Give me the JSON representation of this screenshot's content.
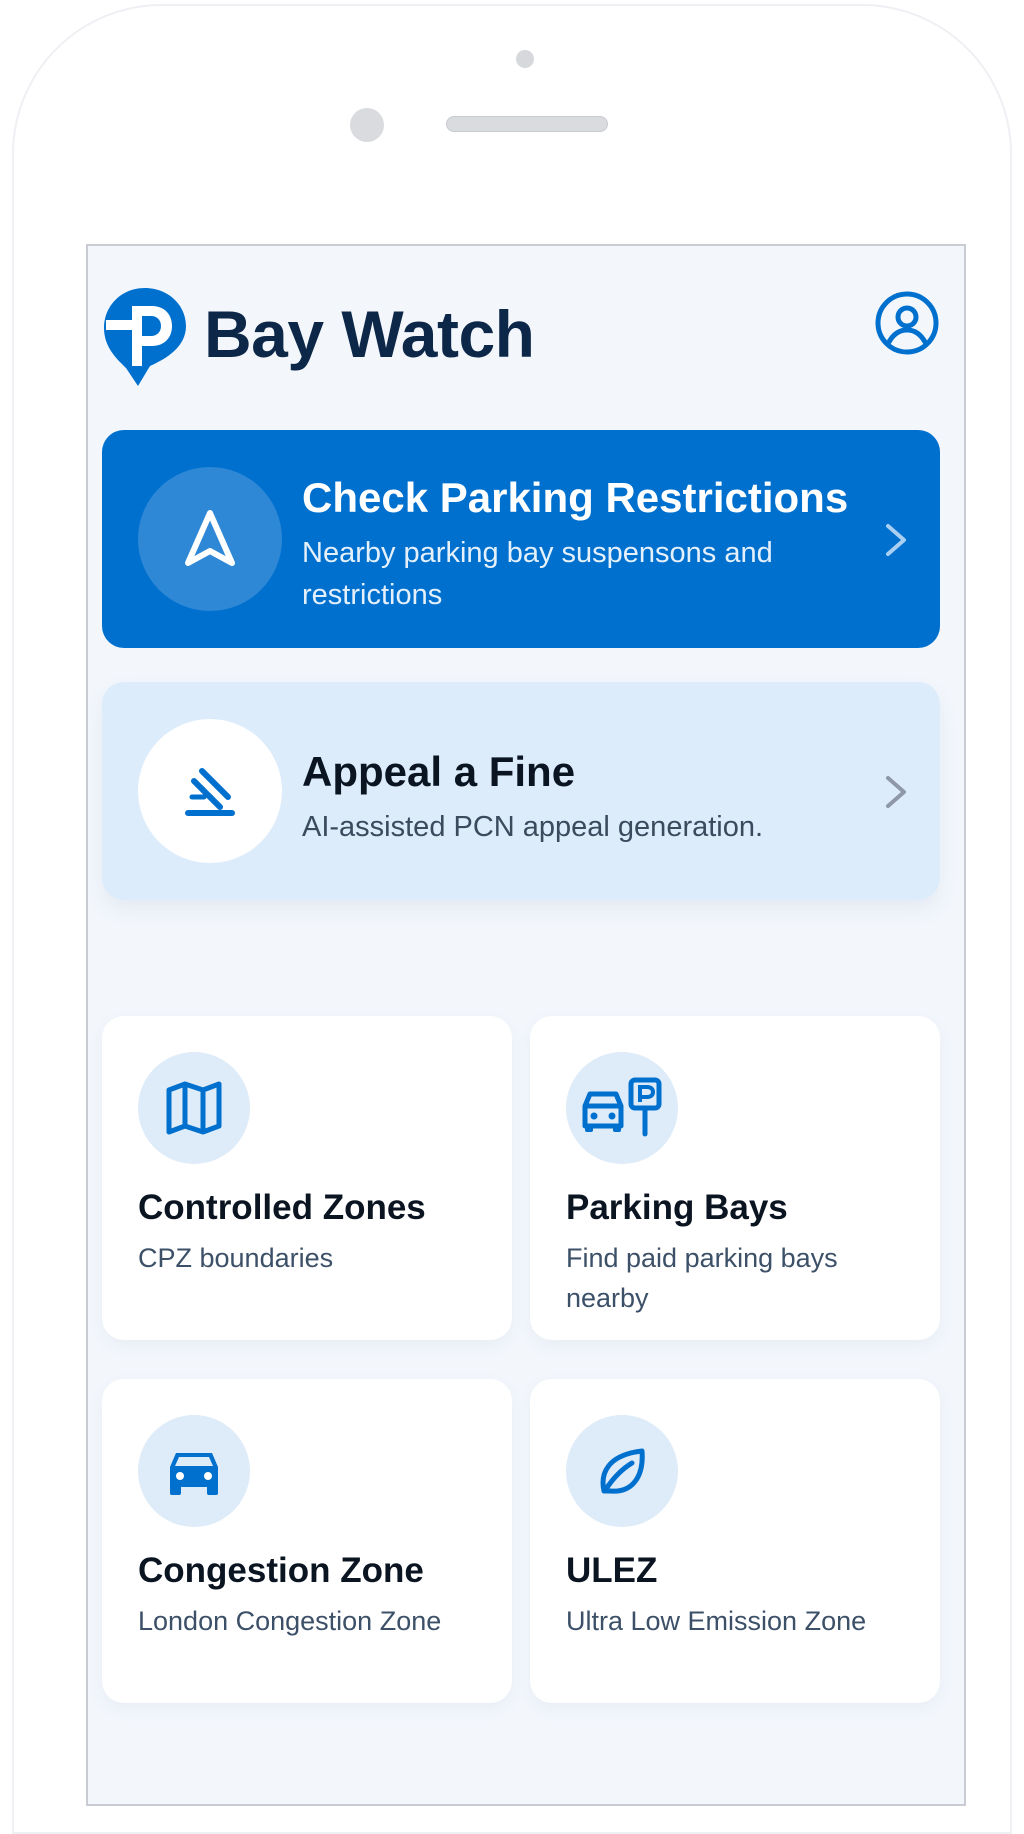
{
  "app": {
    "title": "Bay Watch",
    "logo_icon": "parking-pin-logo",
    "account_icon": "user-circle-icon"
  },
  "colors": {
    "primary": "#0070CE",
    "secondary_card": "#DDECFB",
    "heading": "#0C2748",
    "screen_bg": "#F3F7FC"
  },
  "hero_cards": [
    {
      "title": "Check Parking Restrictions",
      "subtitle": "Nearby parking bay suspensons and restrictions",
      "icon": "navigation-arrow-icon"
    },
    {
      "title": "Appeal a Fine",
      "subtitle": "AI-assisted PCN appeal generation.",
      "icon": "gavel-icon"
    }
  ],
  "tiles": [
    {
      "title": "Controlled Zones",
      "subtitle": "CPZ boundaries",
      "icon": "map-icon"
    },
    {
      "title": "Parking Bays",
      "subtitle": "Find paid parking bays nearby",
      "icon": "car-parking-sign-icon"
    },
    {
      "title": "Congestion Zone",
      "subtitle": "London Congestion Zone",
      "icon": "car-icon"
    },
    {
      "title": "ULEZ",
      "subtitle": "Ultra Low Emission Zone",
      "icon": "leaf-icon"
    }
  ]
}
